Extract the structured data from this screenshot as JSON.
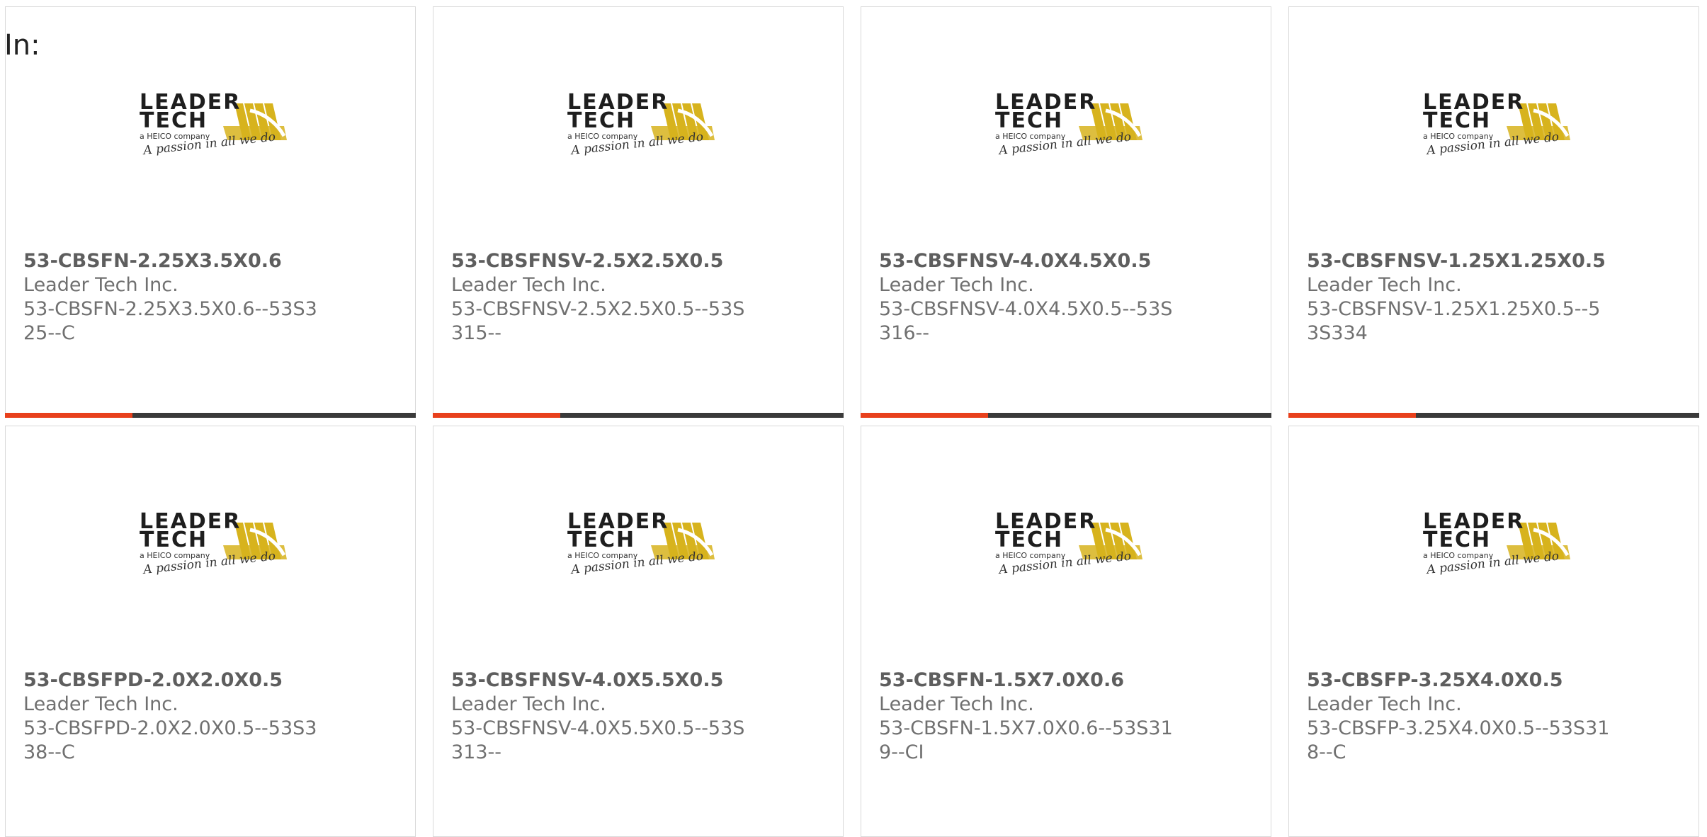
{
  "header": {
    "in_label": "In:"
  },
  "colors": {
    "accent": "#e8401c",
    "bar_track": "#3a3a3a",
    "logo_yellow": "#d7b31d",
    "card_border": "#d9d9d9"
  },
  "logo": {
    "icon": "leader-tech-logo",
    "line1": "LEADER",
    "line2": "TECH",
    "tagline1": "a HEICO company",
    "tagline2": "A passion in all we do"
  },
  "products": [
    {
      "name": "53-CBSFN-2.25X3.5X0.6",
      "manufacturer": "Leader Tech Inc.",
      "part_number": "53-CBSFN-2.25X3.5X0.6--53S325--C",
      "progress": 0.31
    },
    {
      "name": "53-CBSFNSV-2.5X2.5X0.5",
      "manufacturer": "Leader Tech Inc.",
      "part_number": "53-CBSFNSV-2.5X2.5X0.5--53S315--",
      "progress": 0.31
    },
    {
      "name": "53-CBSFNSV-4.0X4.5X0.5",
      "manufacturer": "Leader Tech Inc.",
      "part_number": "53-CBSFNSV-4.0X4.5X0.5--53S316--",
      "progress": 0.31
    },
    {
      "name": "53-CBSFNSV-1.25X1.25X0.5",
      "manufacturer": "Leader Tech Inc.",
      "part_number": "53-CBSFNSV-1.25X1.25X0.5--53S334",
      "progress": 0.31
    },
    {
      "name": "53-CBSFPD-2.0X2.0X0.5",
      "manufacturer": "Leader Tech Inc.",
      "part_number": "53-CBSFPD-2.0X2.0X0.5--53S338--C",
      "progress": 0.31
    },
    {
      "name": "53-CBSFNSV-4.0X5.5X0.5",
      "manufacturer": "Leader Tech Inc.",
      "part_number": "53-CBSFNSV-4.0X5.5X0.5--53S313--",
      "progress": 0.31
    },
    {
      "name": "53-CBSFN-1.5X7.0X0.6",
      "manufacturer": "Leader Tech Inc.",
      "part_number": "53-CBSFN-1.5X7.0X0.6--53S319--CI",
      "progress": 0.31
    },
    {
      "name": "53-CBSFP-3.25X4.0X0.5",
      "manufacturer": "Leader Tech Inc.",
      "part_number": "53-CBSFP-3.25X4.0X0.5--53S318--C",
      "progress": 0.31
    }
  ]
}
